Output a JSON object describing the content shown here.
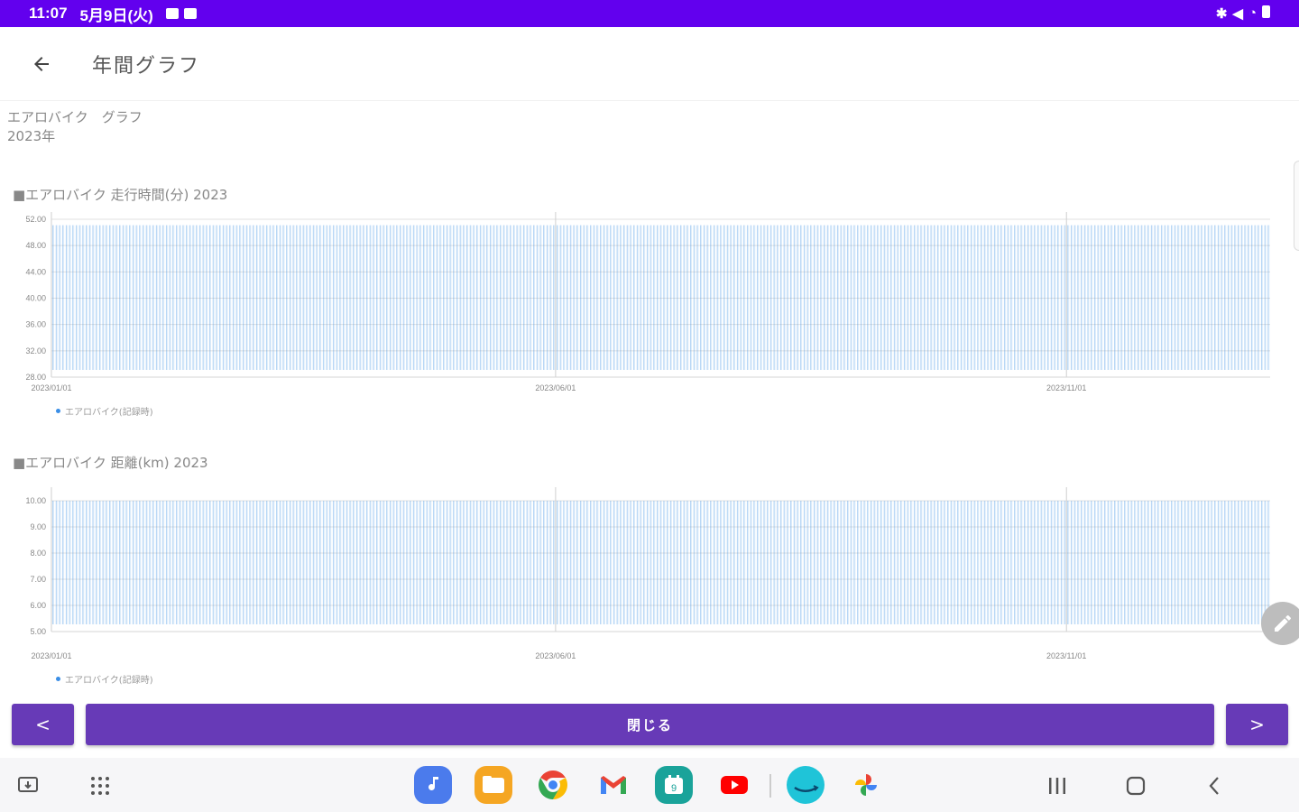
{
  "status": {
    "time": "11:07",
    "date": "5月9日(火)"
  },
  "header": {
    "title": "年間グラフ"
  },
  "subtitle": {
    "line1": "エアロバイク　グラフ",
    "line2": "2023年"
  },
  "charts": [
    {
      "title": "■エアロバイク 走行時間(分) 2023",
      "legend": "エアロバイク(記録時)"
    },
    {
      "title": "■エアロバイク 距離(km) 2023",
      "legend": "エアロバイク(記録時)"
    }
  ],
  "chart_data": [
    {
      "type": "bar",
      "title": "■エアロバイク 走行時間(分) 2023",
      "x_ticks": [
        "2023/01/01",
        "2023/06/01",
        "2023/11/01"
      ],
      "y_ticks": [
        "28.00",
        "32.00",
        "36.00",
        "40.00",
        "44.00",
        "48.00",
        "52.00"
      ],
      "ylim": [
        28,
        52
      ],
      "x_range": [
        "2023/01/01",
        "2023/12/31"
      ],
      "bar_value": 50,
      "bar_color": "#3a8ee6",
      "grid": true,
      "legend": [
        "エアロバイク(記録時)"
      ],
      "legend_position": "bottom-left"
    },
    {
      "type": "bar",
      "title": "■エアロバイク 距離(km) 2023",
      "x_ticks": [
        "2023/01/01",
        "2023/06/01",
        "2023/11/01"
      ],
      "y_ticks": [
        "5.00",
        "6.00",
        "7.00",
        "8.00",
        "9.00",
        "10.00"
      ],
      "ylim": [
        5,
        10
      ],
      "x_range": [
        "2023/01/01",
        "2023/12/31"
      ],
      "bar_value": 10,
      "bar_color": "#3a8ee6",
      "grid": true,
      "legend": [
        "エアロバイク(記録時)"
      ],
      "legend_position": "bottom-left"
    }
  ],
  "buttons": {
    "prev": "<",
    "close": "閉じる",
    "next": ">"
  },
  "colors": {
    "status_bar": "#6200ee",
    "button": "#673ab7",
    "bar": "#3a8ee6"
  },
  "dock": {
    "apps": [
      "music-app-icon",
      "files-app-icon",
      "chrome-app-icon",
      "gmail-app-icon",
      "calendar-app-icon",
      "youtube-app-icon",
      "prime-video-app-icon",
      "photos-app-icon"
    ]
  }
}
